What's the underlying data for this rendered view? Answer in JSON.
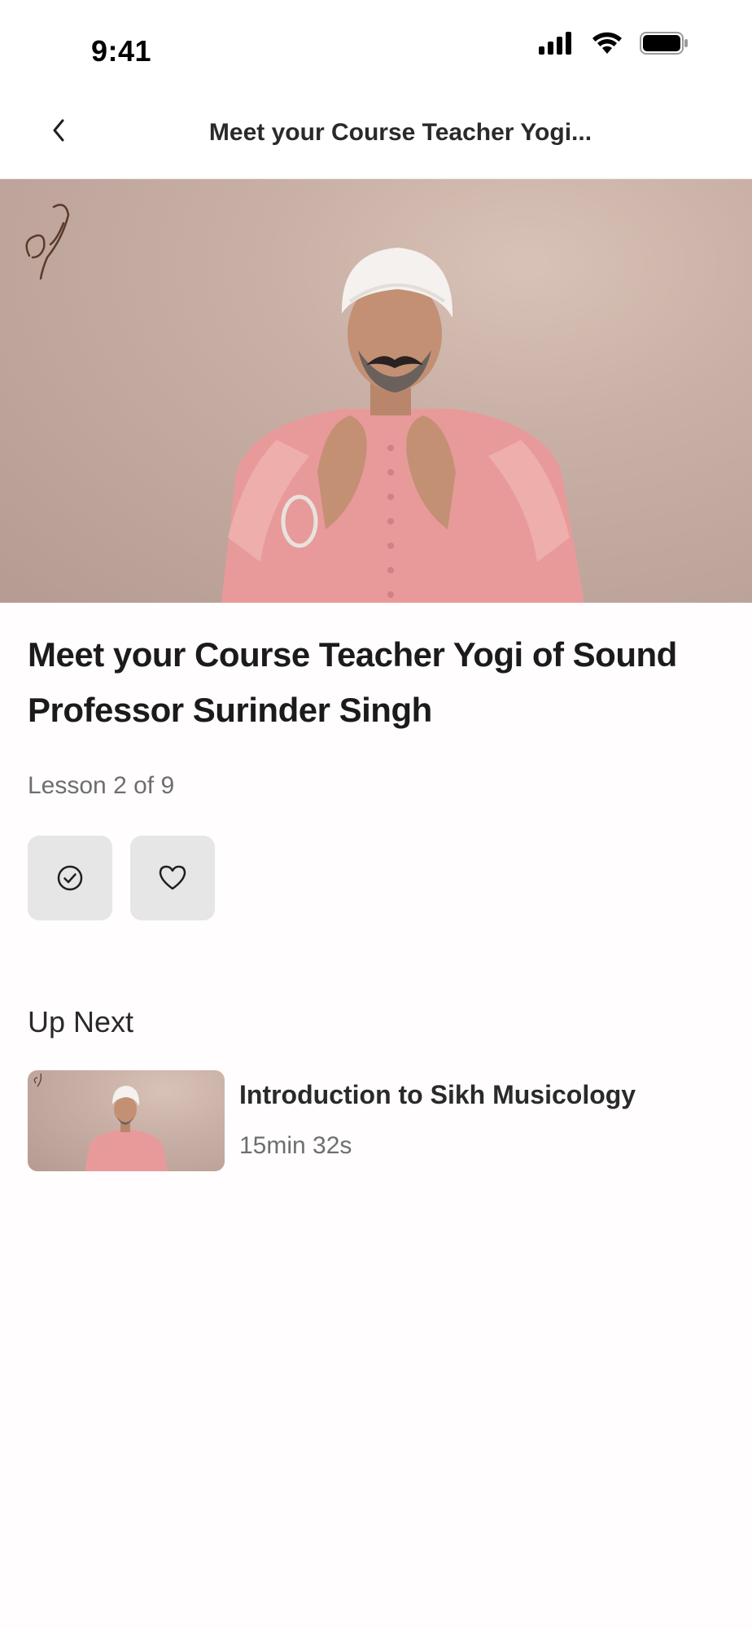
{
  "status_bar": {
    "time": "9:41",
    "icons": [
      "signal-icon",
      "wifi-icon",
      "battery-icon"
    ]
  },
  "nav": {
    "back_icon": "chevron-left-icon",
    "title": "Meet your Course Teacher Yogi..."
  },
  "video": {
    "logo_icon": "script-y-logo"
  },
  "lesson": {
    "title": "Meet your Course Teacher Yogi of Sound Professor Surinder Singh",
    "progress": "Lesson 2 of 9",
    "actions": [
      {
        "name": "complete-button",
        "icon": "check-circle-icon"
      },
      {
        "name": "favorite-button",
        "icon": "heart-icon"
      }
    ]
  },
  "up_next": {
    "heading": "Up Next",
    "items": [
      {
        "title": "Introduction to Sikh Musicology",
        "duration": "15min 32s"
      }
    ]
  },
  "colors": {
    "background": "#fffdfd",
    "action_bg": "#e7e6e6",
    "muted_text": "#6e6e6e",
    "video_bg": "#c9b0a6",
    "shirt_pink": "#e89a9a",
    "turban_white": "#f4f1ee"
  }
}
